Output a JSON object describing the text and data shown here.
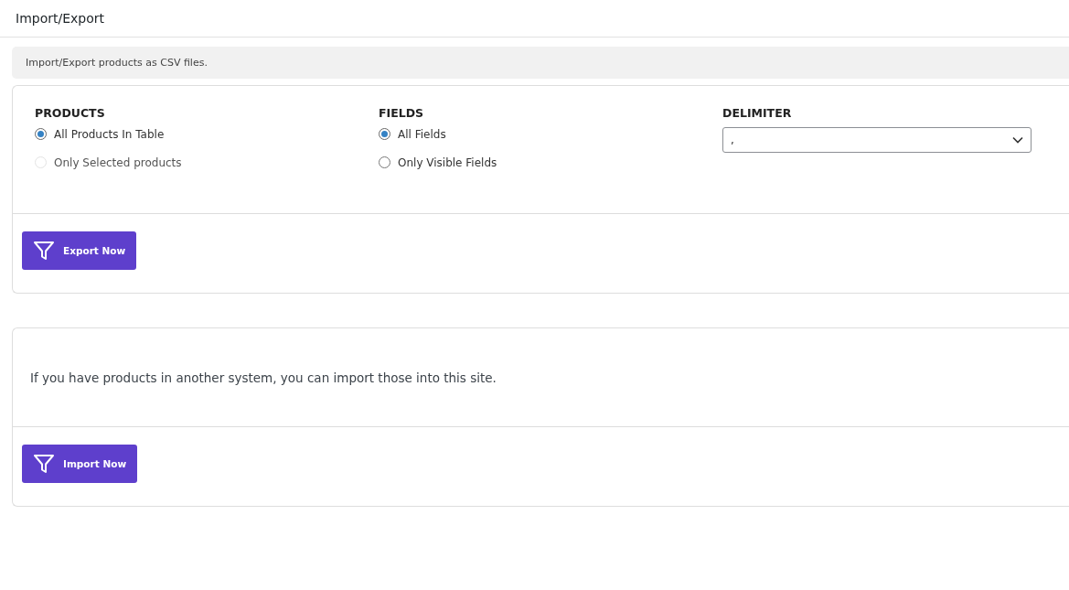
{
  "header": {
    "title": "Import/Export"
  },
  "notice": "Import/Export products as CSV files.",
  "export_card": {
    "groups": [
      {
        "kind": "radio",
        "title": "PRODUCTS",
        "options": [
          {
            "label": "All Products In Table",
            "selected": true,
            "disabled": false
          },
          {
            "label": "Only Selected products",
            "selected": false,
            "disabled": true
          }
        ]
      },
      {
        "kind": "radio",
        "title": "FIELDS",
        "options": [
          {
            "label": "All Fields",
            "selected": true,
            "disabled": false
          },
          {
            "label": "Only Visible Fields",
            "selected": false,
            "disabled": false
          }
        ]
      },
      {
        "kind": "select",
        "title": "DELIMITER",
        "value": ","
      }
    ],
    "button": "Export Now"
  },
  "import_card": {
    "text": "If you have products in another system, you can import those into this site.",
    "button": "Import Now"
  }
}
